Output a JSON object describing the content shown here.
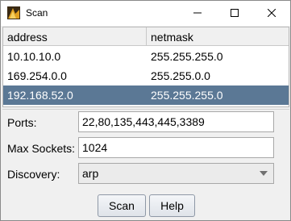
{
  "window": {
    "title": "Scan"
  },
  "table": {
    "columns": [
      "address",
      "netmask"
    ],
    "rows": [
      {
        "address": "10.10.10.0",
        "netmask": "255.255.255.0",
        "selected": false
      },
      {
        "address": "169.254.0.0",
        "netmask": "255.255.0.0",
        "selected": false
      },
      {
        "address": "192.168.52.0",
        "netmask": "255.255.255.0",
        "selected": true
      }
    ]
  },
  "form": {
    "ports": {
      "label": "Ports:",
      "value": "22,80,135,443,445,3389"
    },
    "max_sockets": {
      "label": "Max Sockets:",
      "value": "1024"
    },
    "discovery": {
      "label": "Discovery:",
      "value": "arp"
    }
  },
  "buttons": {
    "scan": "Scan",
    "help": "Help"
  },
  "icons": {
    "app": "app-icon",
    "minimize": "minimize-icon",
    "maximize": "maximize-icon",
    "close": "close-icon",
    "dropdown": "chevron-down-icon"
  },
  "colors": {
    "selection": "#5b7895",
    "titlebar": "#ffffff",
    "background": "#f0f0f0"
  }
}
